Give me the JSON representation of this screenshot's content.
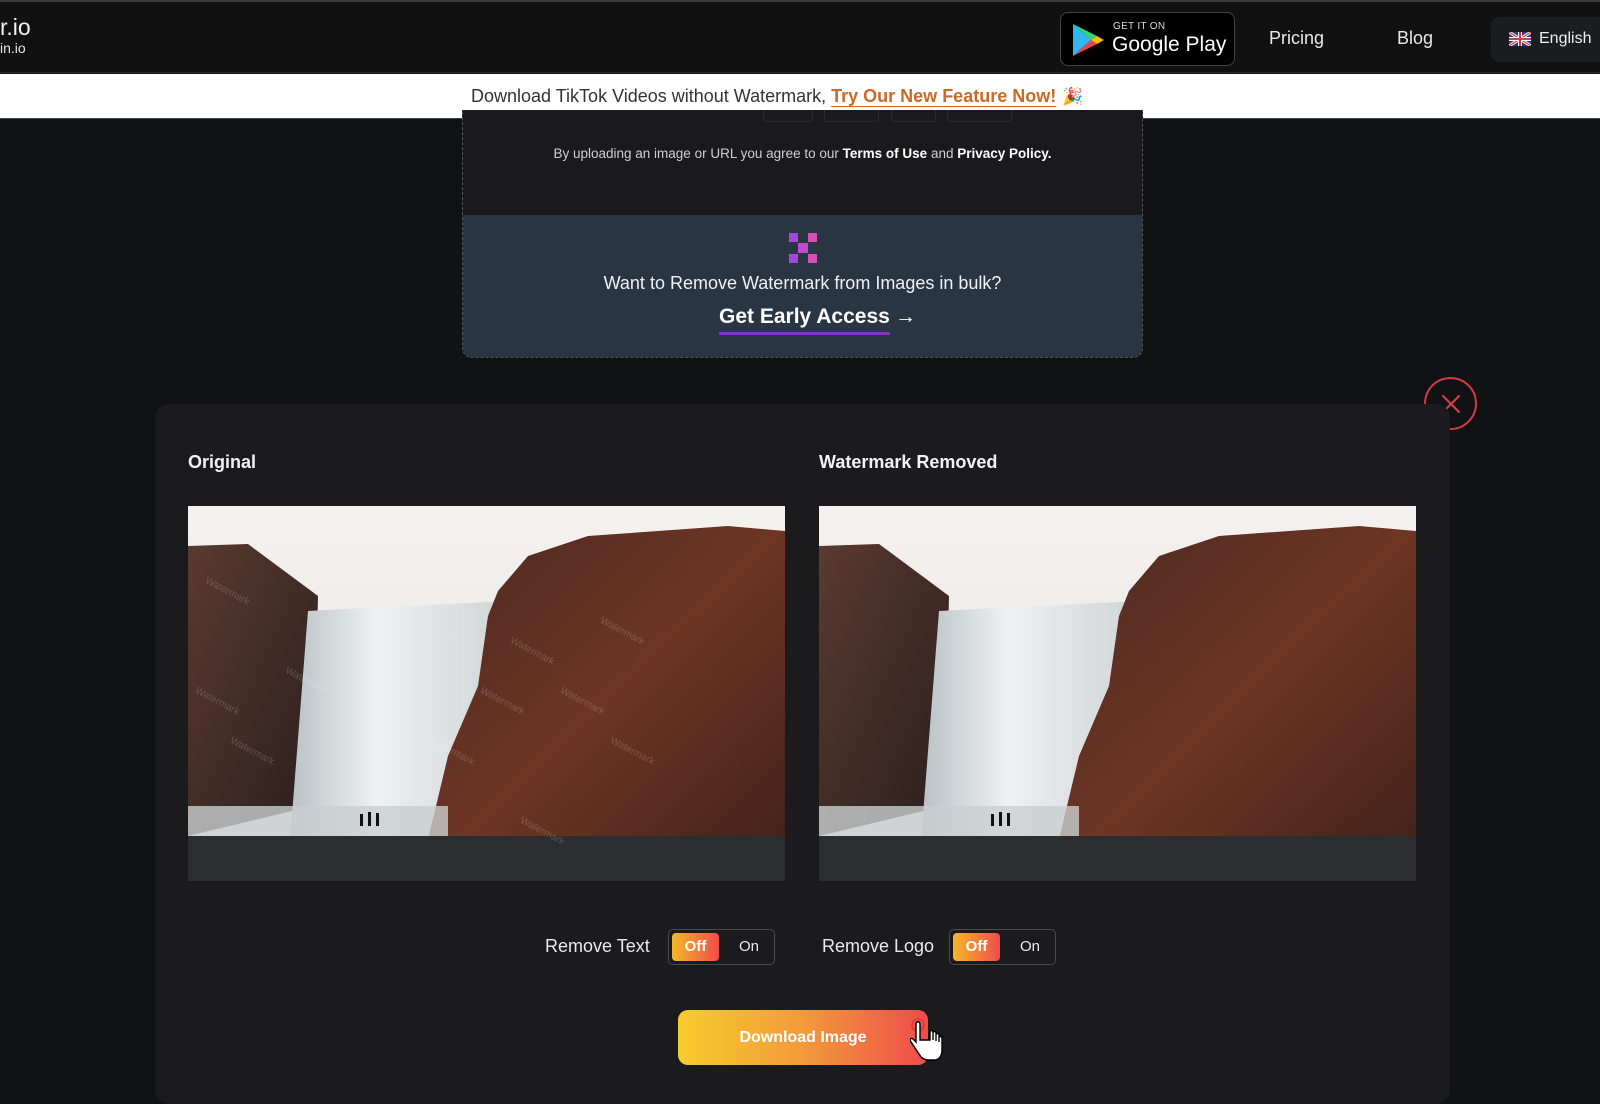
{
  "header": {
    "logo_main": "r.io",
    "logo_sub": "in.io",
    "google_play": {
      "small": "GET IT ON",
      "big": "Google Play"
    },
    "nav": [
      {
        "label": "Pricing"
      },
      {
        "label": "Blog"
      }
    ],
    "language": {
      "label": "English",
      "flag": "uk-flag"
    }
  },
  "promo": {
    "text": "Download TikTok Videos without Watermark, ",
    "link": "Try Our New Feature Now!",
    "emoji": "🎉",
    "link_color": "#c96a28"
  },
  "upload": {
    "terms_prefix": "By uploading an image or URL you agree to our ",
    "terms_link": "Terms of Use",
    "terms_mid": " and ",
    "privacy_link": "Privacy Policy."
  },
  "bulk": {
    "icon": "grid-x-icon",
    "question": "Want to Remove Watermark from Images in bulk?",
    "cta": "Get Early Access",
    "arrow": "→",
    "accent": "#8b2fc9"
  },
  "result": {
    "original_title": "Original",
    "removed_title": "Watermark Removed",
    "watermark_text": "Watermark",
    "toggles": [
      {
        "label": "Remove Text",
        "off": "Off",
        "on": "On",
        "state": "off"
      },
      {
        "label": "Remove Logo",
        "off": "Off",
        "on": "On",
        "state": "off"
      }
    ],
    "download_label": "Download Image",
    "close_color": "#d23b46"
  }
}
